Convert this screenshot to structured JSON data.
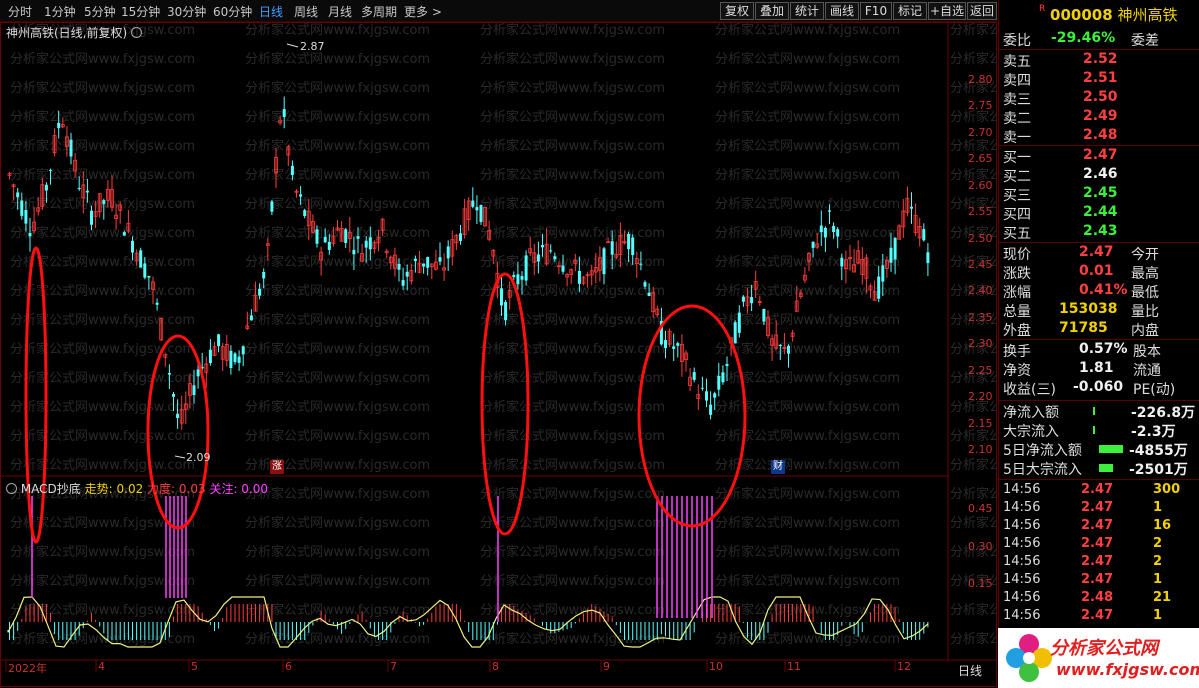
{
  "topbar": {
    "periods": [
      "分时",
      "1分钟",
      "5分钟",
      "15分钟",
      "30分钟",
      "60分钟",
      "日线",
      "周线",
      "月线",
      "多周期",
      "更多 >"
    ],
    "active_period": "日线",
    "tools": [
      "复权",
      "叠加",
      "统计",
      "画线",
      "F10",
      "标记",
      "+自选",
      "返回"
    ]
  },
  "chart": {
    "title": "神州高铁(日线,前复权)",
    "max_label": "2.87",
    "min_label": "2.09",
    "marker_zhang": "涨",
    "marker_cai": "财",
    "yaxis": [
      "2.80",
      "2.75",
      "2.70",
      "2.65",
      "2.60",
      "2.55",
      "2.50",
      "2.45",
      "2.40",
      "2.35",
      "2.30",
      "2.25",
      "2.20",
      "2.15",
      "2.10"
    ],
    "xaxis": [
      "2022年",
      "4",
      "5",
      "6",
      "7",
      "8",
      "9",
      "10",
      "11",
      "12"
    ],
    "period_label": "日线",
    "watermark": "分析家公式网www.fxjgsw.com"
  },
  "macd": {
    "name": "MACD抄底",
    "trend_label": "走势: 0.02",
    "strength_label": "力度: 0.03",
    "focus_label": "关注: 0.00",
    "yaxis": [
      "0.45",
      "0.30",
      "0.15"
    ]
  },
  "side": {
    "code": "000008",
    "name": "神州高铁",
    "r_mark": "R",
    "weibi_label": "委比",
    "weibi_val": "-29.46%",
    "weicha_label": "委差",
    "asks": [
      {
        "label": "卖五",
        "price": "2.52"
      },
      {
        "label": "卖四",
        "price": "2.51"
      },
      {
        "label": "卖三",
        "price": "2.50"
      },
      {
        "label": "卖二",
        "price": "2.49"
      },
      {
        "label": "卖一",
        "price": "2.48"
      }
    ],
    "bids": [
      {
        "label": "买一",
        "price": "2.47"
      },
      {
        "label": "买二",
        "price": "2.46"
      },
      {
        "label": "买三",
        "price": "2.45"
      },
      {
        "label": "买四",
        "price": "2.44"
      },
      {
        "label": "买五",
        "price": "2.43"
      }
    ],
    "quote": [
      {
        "label": "现价",
        "value": "2.47",
        "label2": "今开"
      },
      {
        "label": "涨跌",
        "value": "0.01",
        "label2": "最高"
      },
      {
        "label": "涨幅",
        "value": "0.41%",
        "label2": "最低"
      },
      {
        "label": "总量",
        "value": "153038",
        "label2": "量比"
      },
      {
        "label": "外盘",
        "value": "71785",
        "label2": "内盘"
      }
    ],
    "stats": [
      {
        "label": "换手",
        "value": "0.57%",
        "label2": "股本"
      },
      {
        "label": "净资",
        "value": "1.81",
        "label2": "流通"
      },
      {
        "label": "收益(三)",
        "value": "-0.060",
        "label2": "PE(动)"
      }
    ],
    "flows": [
      {
        "label": "净流入额",
        "value": "-226.8万"
      },
      {
        "label": "大宗流入",
        "value": "-2.3万"
      },
      {
        "label": "5日净流入额",
        "value": "-4855万"
      },
      {
        "label": "5日大宗流入",
        "value": "-2501万"
      }
    ],
    "ticks": [
      {
        "time": "14:56",
        "price": "2.47",
        "vol": "300"
      },
      {
        "time": "14:56",
        "price": "2.47",
        "vol": "1"
      },
      {
        "time": "14:56",
        "price": "2.47",
        "vol": "16"
      },
      {
        "time": "14:56",
        "price": "2.47",
        "vol": "2"
      },
      {
        "time": "14:56",
        "price": "2.47",
        "vol": "2"
      },
      {
        "time": "14:56",
        "price": "2.47",
        "vol": "1"
      },
      {
        "time": "14:56",
        "price": "2.48",
        "vol": "21"
      },
      {
        "time": "14:56",
        "price": "2.47",
        "vol": "1"
      }
    ],
    "logo_text": "分析家公式网",
    "logo_url": "www.fxjgsw.com"
  }
}
